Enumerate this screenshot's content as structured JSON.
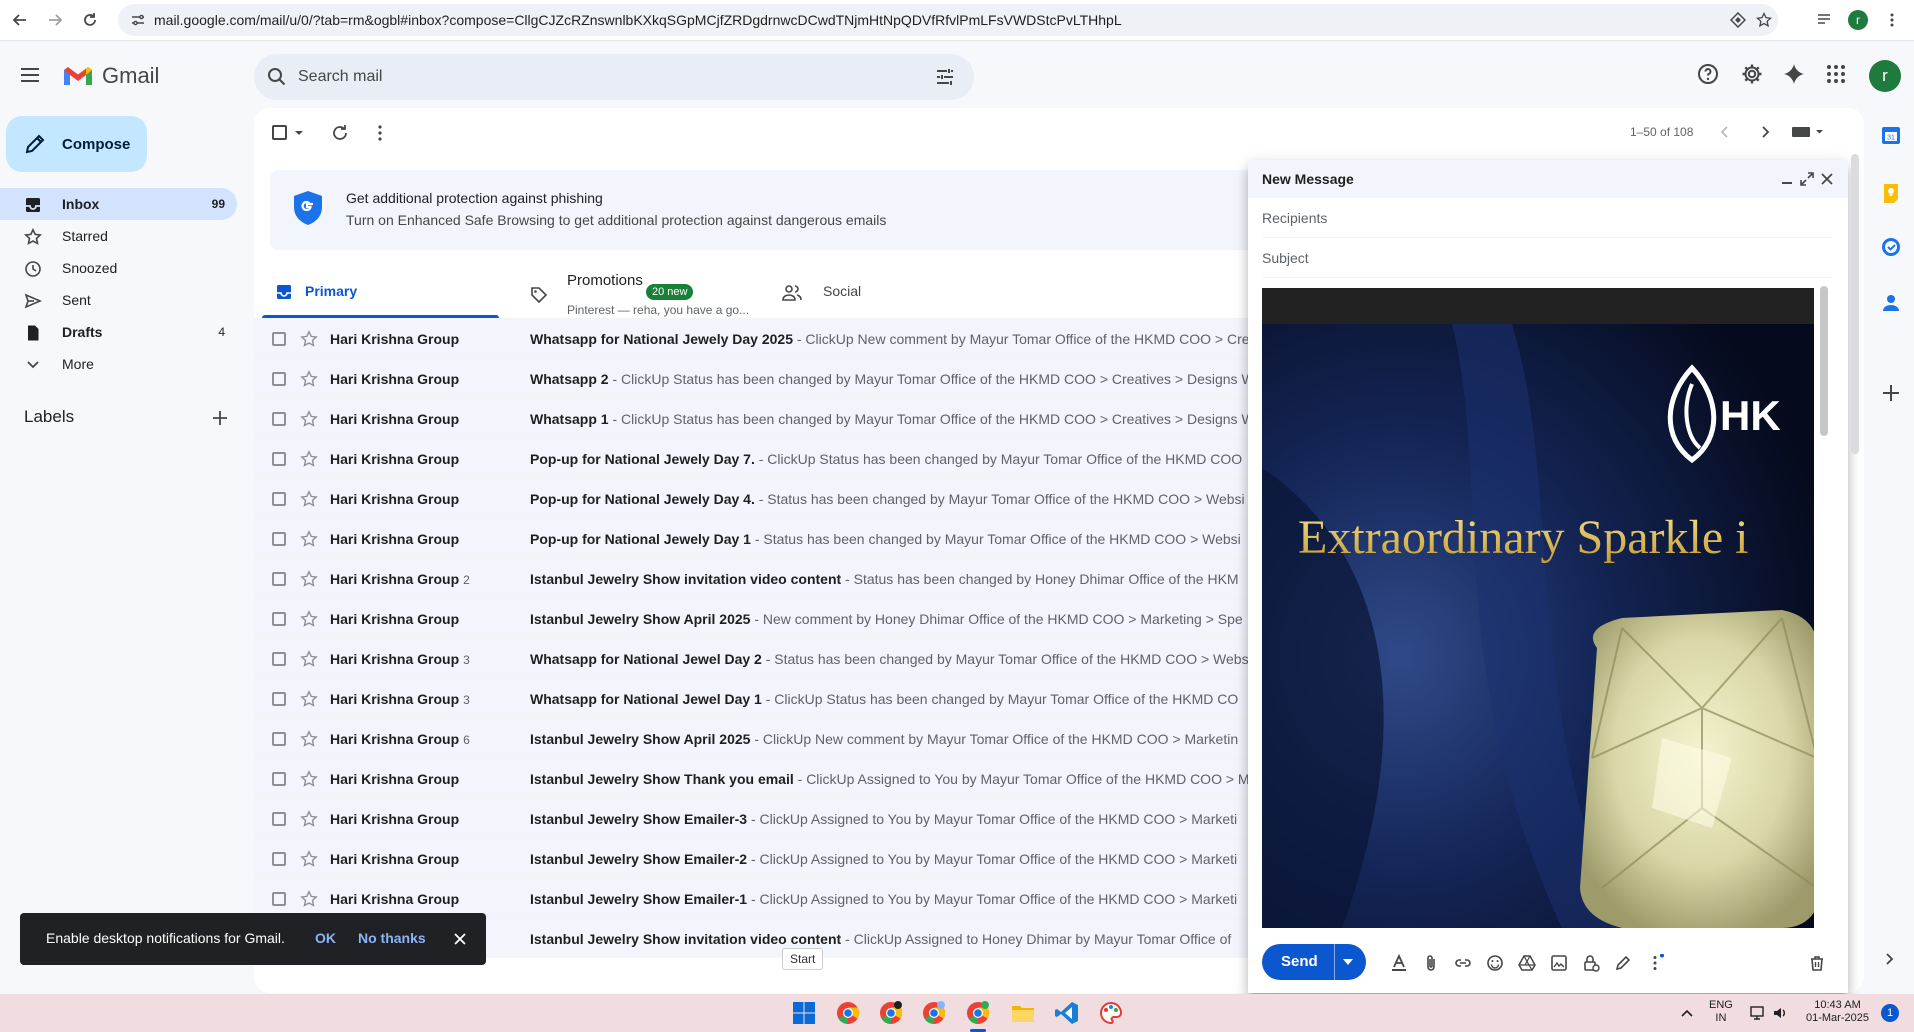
{
  "browser": {
    "url": "mail.google.com/mail/u/0/?tab=rm&ogbl#inbox?compose=CllgCJZcRZnswnlbKXkqSGpMCjfZRDgdrnwcDCwdTNjmHtNpQDVfRfvlPmLFsVWDStcPvLTHhpL",
    "profile_initial": "r"
  },
  "header": {
    "app_name": "Gmail",
    "search_placeholder": "Search mail",
    "profile_initial": "r"
  },
  "sidebar": {
    "compose_label": "Compose",
    "items": [
      {
        "label": "Inbox",
        "count": "99"
      },
      {
        "label": "Starred",
        "count": ""
      },
      {
        "label": "Snoozed",
        "count": ""
      },
      {
        "label": "Sent",
        "count": ""
      },
      {
        "label": "Drafts",
        "count": "4"
      },
      {
        "label": "More",
        "count": ""
      }
    ],
    "labels_heading": "Labels"
  },
  "toolbar": {
    "pager": "1–50 of 108"
  },
  "banner": {
    "title": "Get additional protection against phishing",
    "text": "Turn on Enhanced Safe Browsing to get additional protection against dangerous emails"
  },
  "tabs": {
    "primary": "Primary",
    "promotions": "Promotions",
    "promotions_badge": "20 new",
    "promotions_sub": "Pinterest — reha, you have a go...",
    "social": "Social"
  },
  "emails": [
    {
      "from": "Hari Krishna Group",
      "count": "",
      "subject": "Whatsapp for National Jewely Day 2025",
      "snippet": " - ClickUp New comment by Mayur Tomar Office of the HKMD COO > Creatives"
    },
    {
      "from": "Hari Krishna Group",
      "count": "",
      "subject": "Whatsapp 2",
      "snippet": " - ClickUp Status has been changed by Mayur Tomar Office of the HKMD COO > Creatives > Designs W"
    },
    {
      "from": "Hari Krishna Group",
      "count": "",
      "subject": "Whatsapp 1",
      "snippet": " - ClickUp Status has been changed by Mayur Tomar Office of the HKMD COO > Creatives > Designs W"
    },
    {
      "from": "Hari Krishna Group",
      "count": "",
      "subject": "Pop-up for National Jewely Day 7.",
      "snippet": " - ClickUp Status has been changed by Mayur Tomar Office of the HKMD COO"
    },
    {
      "from": "Hari Krishna Group",
      "count": "",
      "subject": "Pop-up for National Jewely Day 4.",
      "snippet": " - Status has been changed by Mayur Tomar Office of the HKMD COO > Websi"
    },
    {
      "from": "Hari Krishna Group",
      "count": "",
      "subject": "Pop-up for National Jewely Day 1",
      "snippet": " - Status has been changed by Mayur Tomar Office of the HKMD COO > Websi"
    },
    {
      "from": "Hari Krishna Group",
      "count": "2",
      "subject": "Istanbul Jewelry Show invitation video content",
      "snippet": " - Status has been changed by Honey Dhimar Office of the HKM"
    },
    {
      "from": "Hari Krishna Group",
      "count": "",
      "subject": "Istanbul Jewelry Show April 2025",
      "snippet": " - New comment by Honey Dhimar Office of the HKMD COO > Marketing > Spe"
    },
    {
      "from": "Hari Krishna Group",
      "count": "3",
      "subject": "Whatsapp for National Jewel Day 2",
      "snippet": " - Status has been changed by Mayur Tomar Office of the HKMD COO > Websi"
    },
    {
      "from": "Hari Krishna Group",
      "count": "3",
      "subject": "Whatsapp for National Jewel Day 1",
      "snippet": " - ClickUp Status has been changed by Mayur Tomar Office of the HKMD CO"
    },
    {
      "from": "Hari Krishna Group",
      "count": "6",
      "subject": "Istanbul Jewelry Show April 2025",
      "snippet": " - ClickUp New comment by Mayur Tomar Office of the HKMD COO > Marketin"
    },
    {
      "from": "Hari Krishna Group",
      "count": "",
      "subject": "Istanbul Jewelry Show Thank you email",
      "snippet": " - ClickUp Assigned to You by Mayur Tomar Office of the HKMD COO > Mark"
    },
    {
      "from": "Hari Krishna Group",
      "count": "",
      "subject": "Istanbul Jewelry Show Emailer-3",
      "snippet": " - ClickUp Assigned to You by Mayur Tomar Office of the HKMD COO > Marketi"
    },
    {
      "from": "Hari Krishna Group",
      "count": "",
      "subject": "Istanbul Jewelry Show Emailer-2",
      "snippet": " - ClickUp Assigned to You by Mayur Tomar Office of the HKMD COO > Marketi"
    },
    {
      "from": "Hari Krishna Group",
      "count": "",
      "subject": "Istanbul Jewelry Show Emailer-1",
      "snippet": " - ClickUp Assigned to You by Mayur Tomar Office of the HKMD COO > Marketi"
    },
    {
      "from": "",
      "count": "",
      "subject": "Istanbul Jewelry Show invitation video content",
      "snippet": " - ClickUp Assigned to Honey Dhimar by Mayur Tomar Office of"
    }
  ],
  "toast": {
    "text": "Enable desktop notifications for Gmail.",
    "ok": "OK",
    "no_thanks": "No thanks"
  },
  "tooltip": "Start",
  "compose": {
    "title": "New Message",
    "recipients_placeholder": "Recipients",
    "subject_placeholder": "Subject",
    "image_headline": "Extraordinary Sparkle i",
    "image_logo_text": "HK",
    "send_label": "Send"
  },
  "taskbar": {
    "lang_top": "ENG",
    "lang_bottom": "IN",
    "time": "10:43 AM",
    "date": "01-Mar-2025",
    "notification_count": "1"
  },
  "colors": {
    "accent": "#0b57d0",
    "compose_bg": "#c2e7ff",
    "active_nav": "#d3e3fd",
    "promo_badge": "#188038"
  }
}
